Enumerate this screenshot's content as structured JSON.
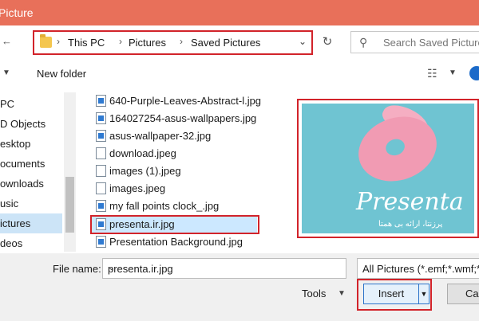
{
  "window": {
    "title": "Picture"
  },
  "address": {
    "crumbs": [
      "This PC",
      "Pictures",
      "Saved Pictures"
    ]
  },
  "search": {
    "placeholder": "Search Saved Pictures"
  },
  "toolbar": {
    "new_folder": "New folder"
  },
  "nav": {
    "items": [
      {
        "label": "PC",
        "selected": false
      },
      {
        "label": "D Objects",
        "selected": false
      },
      {
        "label": "esktop",
        "selected": false
      },
      {
        "label": "ocuments",
        "selected": false
      },
      {
        "label": "ownloads",
        "selected": false
      },
      {
        "label": "usic",
        "selected": false
      },
      {
        "label": "ictures",
        "selected": true
      },
      {
        "label": "deos",
        "selected": false
      }
    ]
  },
  "files": [
    {
      "name": "640-Purple-Leaves-Abstract-l.jpg",
      "icon": "image"
    },
    {
      "name": "164027254-asus-wallpapers.jpg",
      "icon": "image"
    },
    {
      "name": "asus-wallpaper-32.jpg",
      "icon": "image"
    },
    {
      "name": "download.jpeg",
      "icon": "file"
    },
    {
      "name": "images (1).jpeg",
      "icon": "file"
    },
    {
      "name": "images.jpeg",
      "icon": "file"
    },
    {
      "name": "my fall points  clock_.jpg",
      "icon": "image"
    },
    {
      "name": "presenta.ir.jpg",
      "icon": "image",
      "selected": true
    },
    {
      "name": "Presentation Background.jpg",
      "icon": "image"
    }
  ],
  "preview": {
    "brand": "Presenta",
    "subtitle": "پرزنتا، ارائه بی همتا"
  },
  "bottom": {
    "file_name_label": "File name:",
    "file_name_value": "presenta.ir.jpg",
    "filter": "All Pictures (*.emf;*.wmf;*.",
    "tools": "Tools",
    "insert": "Insert",
    "cancel": "Canc"
  },
  "colors": {
    "titlebar": "#e8705a",
    "highlight": "#d2232a",
    "selection": "#cce8ff"
  }
}
